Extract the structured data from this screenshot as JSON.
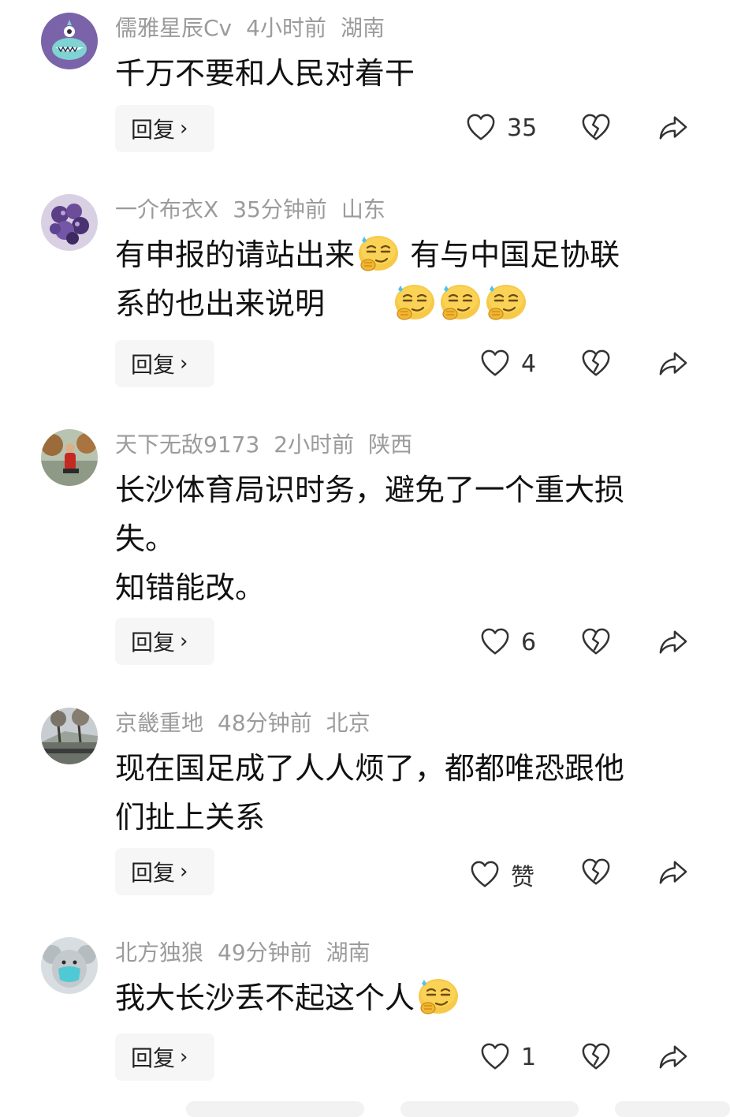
{
  "comments": [
    {
      "username": "儒雅星辰Cv",
      "time": "4小时前",
      "location": "湖南",
      "lines": [
        "千万不要和人民对着干"
      ],
      "reply_label": "回复",
      "like_count": "35"
    },
    {
      "username": "一介布衣X",
      "time": "35分钟前",
      "location": "山东",
      "line1_a": "有申报的请站出来",
      "line1_b": " 有与中国足协联",
      "line2": "系的也出来说明",
      "reply_label": "回复",
      "like_count": "4"
    },
    {
      "username": "天下无敌9173",
      "time": "2小时前",
      "location": "陕西",
      "lines": [
        "长沙体育局识时务，避免了一个重大损",
        "失。",
        "知错能改。"
      ],
      "reply_label": "回复",
      "like_count": "6"
    },
    {
      "username": "京畿重地",
      "time": "48分钟前",
      "location": "北京",
      "lines": [
        "现在国足成了人人烦了，都都唯恐跟他",
        "们扯上关系"
      ],
      "reply_label": "回复",
      "like_count": "赞"
    },
    {
      "username": "北方独狼",
      "time": "49分钟前",
      "location": "湖南",
      "line1": "我大长沙丢不起这个人",
      "reply_label": "回复",
      "like_count": "1"
    }
  ],
  "icons": {
    "like": "heart-icon",
    "dislike": "broken-heart-icon",
    "share": "share-arrow-icon",
    "reply_chevron": "chevron-right-icon",
    "emoji": "smirk-thinking-emoji"
  },
  "colors": {
    "meta_text": "#9b9b9b",
    "body_text": "#111111",
    "reply_bg": "#f6f6f6",
    "icon_stroke": "#333333"
  }
}
